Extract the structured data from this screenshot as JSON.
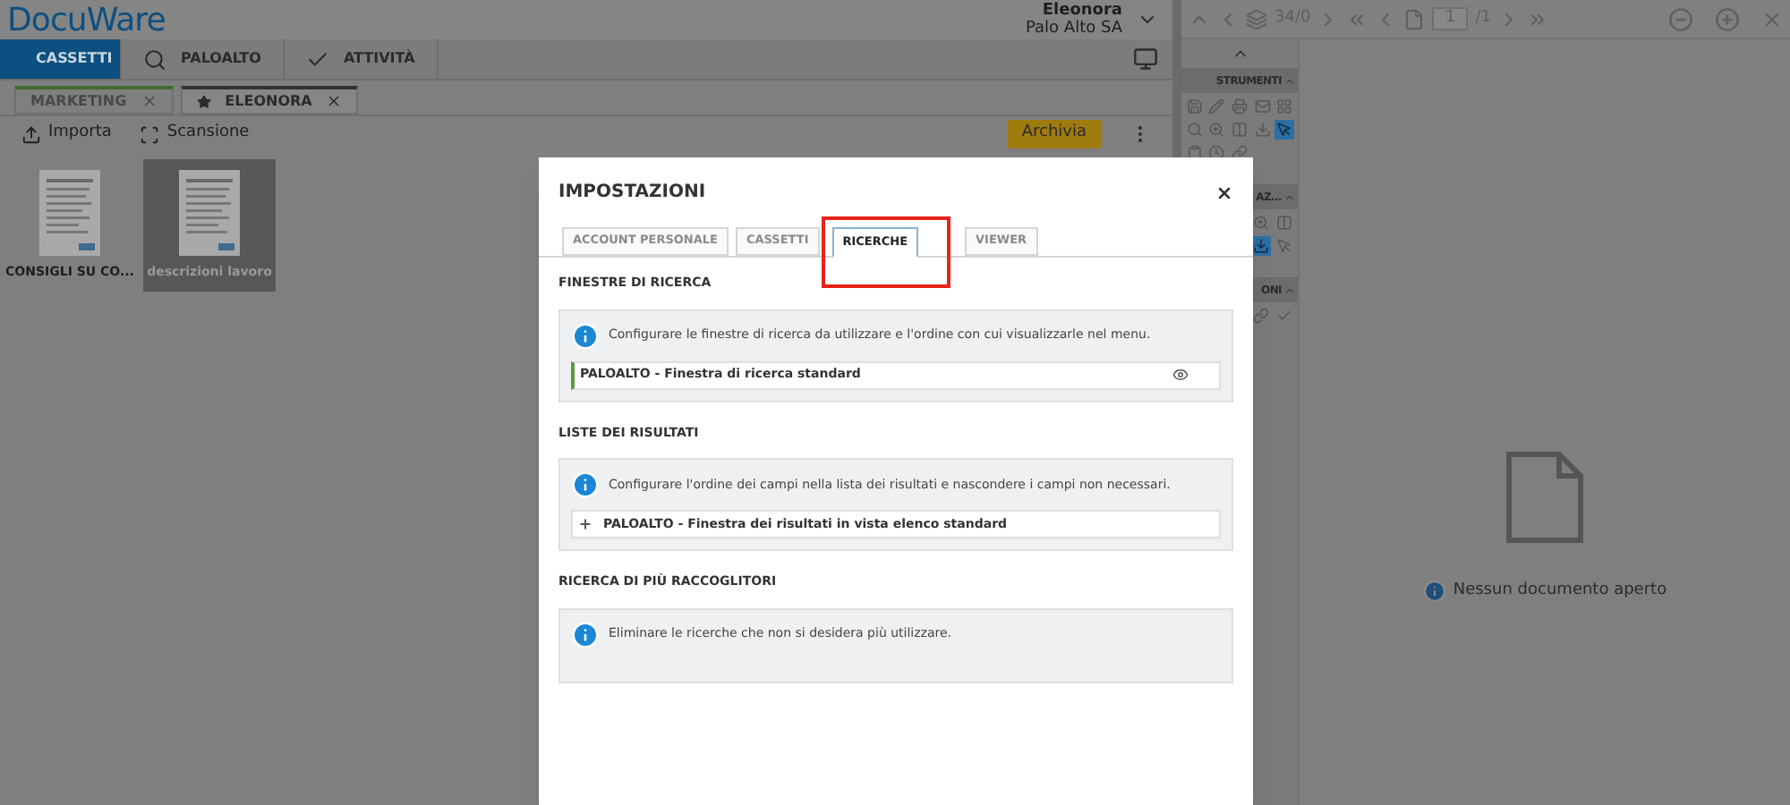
{
  "header": {
    "logo": "DocuWare",
    "user_name": "Eleonora",
    "company": "Palo Alto SA"
  },
  "nav": [
    {
      "label": "CASSETTI",
      "selected": true
    },
    {
      "label": "PALOALTO",
      "selected": false
    },
    {
      "label": "ATTIVITÀ",
      "selected": false
    }
  ],
  "cabinet_tabs": [
    {
      "label": "MARKETING",
      "selected": false,
      "starred": false
    },
    {
      "label": "ELEONORA",
      "selected": true,
      "starred": true
    }
  ],
  "toolbar": {
    "actions": [
      "Importa",
      "Scansione"
    ],
    "archive_button": "Archivia"
  },
  "documents": [
    {
      "name": "CONSIGLI SU CO...",
      "selected": false
    },
    {
      "name": "descrizioni lavoro",
      "selected": true
    }
  ],
  "viewer_toolbar": {
    "count": "34/0",
    "page": "1",
    "total": "/1"
  },
  "tool_groups": [
    {
      "title": "STRUMENTI",
      "tools": [
        {
          "selected": false
        },
        {
          "selected": false
        },
        {
          "selected": false
        },
        {
          "selected": false
        },
        {
          "selected": false
        },
        {
          "selected": false
        },
        {
          "selected": false
        },
        {
          "selected": false
        },
        {
          "selected": false
        },
        {
          "selected": true
        },
        {
          "selected": false
        },
        {
          "selected": false
        },
        {
          "selected": false
        }
      ]
    },
    {
      "title": "AZ...",
      "tools": [
        {
          "selected": false
        },
        {
          "selected": false
        },
        {
          "selected": true
        },
        {
          "selected": false
        }
      ]
    },
    {
      "title": "ONI",
      "tools": [
        {
          "selected": false
        },
        {
          "selected": false
        }
      ]
    }
  ],
  "viewer": {
    "message": "Nessun documento aperto"
  },
  "dialog": {
    "title": "IMPOSTAZIONI",
    "tabs": [
      {
        "label": "ACCOUNT PERSONALE",
        "selected": false
      },
      {
        "label": "CASSETTI",
        "selected": false
      },
      {
        "label": "RICERCHE",
        "selected": true
      },
      {
        "label": "VIEWER",
        "selected": false
      }
    ],
    "sections": [
      {
        "title": "FINESTRE DI RICERCA",
        "info": "Configurare le finestre di ricerca da utilizzare e l'ordine con cui visualizzarle nel menu.",
        "items": [
          {
            "kind": "visible",
            "label": "PALOALTO - Finestra di ricerca standard"
          }
        ]
      },
      {
        "title": "LISTE DEI RISULTATI",
        "info": "Configurare l'ordine dei campi nella lista dei risultati e nascondere i campi non necessari.",
        "items": [
          {
            "kind": "expandable",
            "label": "PALOALTO - Finestra dei risultati in vista elenco standard"
          }
        ]
      },
      {
        "title": "RICERCA DI PIÙ RACCOGLITORI",
        "info": "Eliminare le ricerche che non si desidera più utilizzare."
      }
    ]
  },
  "annotation": {
    "highlight_selected_tab": true
  }
}
